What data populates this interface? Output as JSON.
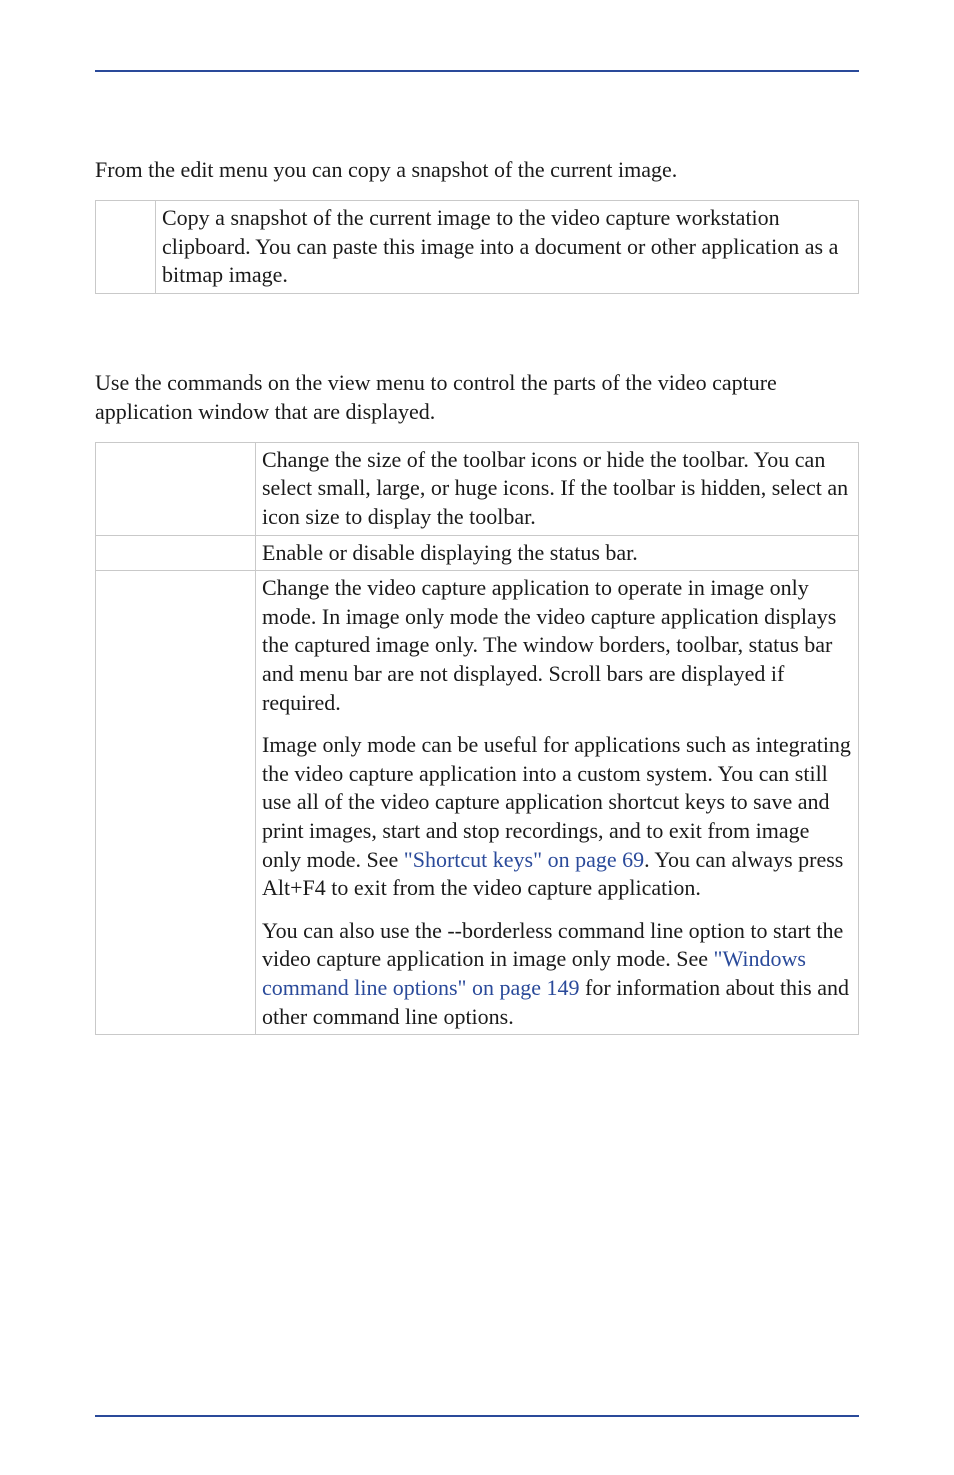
{
  "colors": {
    "rule": "#2a4a9a",
    "link": "#2a4a9a"
  },
  "intro1": "From the edit menu you can copy a snapshot of the current image.",
  "table1": {
    "rows": [
      {
        "left": "",
        "desc": "Copy a snapshot of the current image to the video capture workstation clipboard. You can paste this image into a document or other application as a bitmap image."
      }
    ]
  },
  "intro2": "Use the commands on the view menu to control the parts of the video capture application window that are displayed.",
  "table2": {
    "rows": [
      {
        "left": "",
        "paras": [
          "Change the size of the toolbar icons or hide the toolbar. You can select small, large, or huge icons. If the toolbar is hidden, select an icon size to display the toolbar."
        ]
      },
      {
        "left": "",
        "paras": [
          "Enable or disable displaying the status bar."
        ]
      },
      {
        "left": "",
        "paras": [
          {
            "segments": [
              {
                "t": "Change the video capture application to operate in image only mode. In image only mode the video capture application displays the captured image only. The window borders, toolbar, status bar and menu bar are not displayed. Scroll bars are displayed if required."
              }
            ]
          },
          {
            "segments": [
              {
                "t": "Image only mode can be useful for applications such as integrating the video capture application into a custom system. You can still use all of the video capture application shortcut keys to save and print images, start and stop recordings, and to exit from image only mode. See "
              },
              {
                "t": "\"Shortcut keys\" on page 69",
                "link": true
              },
              {
                "t": ". You can always press Alt+F4 to exit from the video capture application."
              }
            ]
          },
          {
            "segments": [
              {
                "t": "You can also use the --borderless command line option to start the video capture application in image only mode. See "
              },
              {
                "t": "\"Windows command line options\" on page 149",
                "link": true
              },
              {
                "t": " for information about this and other command line options."
              }
            ]
          }
        ]
      }
    ]
  }
}
